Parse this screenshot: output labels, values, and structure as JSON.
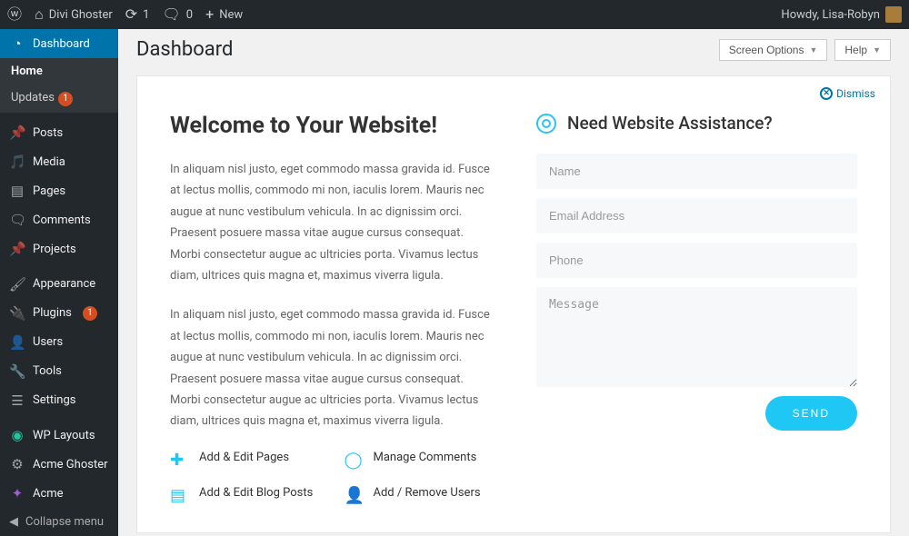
{
  "adminbar": {
    "site_name": "Divi Ghoster",
    "updates_count": "1",
    "comments_count": "0",
    "new_label": "New",
    "howdy": "Howdy, Lisa-Robyn"
  },
  "sidebar": {
    "dashboard": "Dashboard",
    "home": "Home",
    "updates": "Updates",
    "updates_badge": "1",
    "posts": "Posts",
    "media": "Media",
    "pages": "Pages",
    "comments": "Comments",
    "projects": "Projects",
    "appearance": "Appearance",
    "plugins": "Plugins",
    "plugins_badge": "1",
    "users": "Users",
    "tools": "Tools",
    "settings": "Settings",
    "wp_layouts": "WP Layouts",
    "acme_ghoster": "Acme Ghoster",
    "acme": "Acme",
    "collapse": "Collapse menu"
  },
  "page": {
    "title": "Dashboard",
    "screen_options": "Screen Options",
    "help": "Help",
    "dismiss": "Dismiss"
  },
  "welcome": {
    "heading": "Welcome to Your Website!",
    "p1": "In aliquam nisl justo, eget commodo massa gravida id. Fusce at lectus mollis, commodo mi non, iaculis lorem. Mauris nec augue at nunc vestibulum vehicula. In ac dignissim orci. Praesent posuere massa vitae augue cursus consequat. Morbi consectetur augue ac ultricies porta. Vivamus lectus diam, ultrices quis magna et, maximus viverra ligula.",
    "p2": "In aliquam nisl justo, eget commodo massa gravida id. Fusce at lectus mollis, commodo mi non, iaculis lorem. Mauris nec augue at nunc vestibulum vehicula. In ac dignissim orci. Praesent posuere massa vitae augue cursus consequat. Morbi consectetur augue ac ultricies porta. Vivamus lectus diam, ultrices quis magna et, maximus viverra ligula."
  },
  "assist": {
    "heading": "Need Website Assistance?",
    "name_ph": "Name",
    "email_ph": "Email Address",
    "phone_ph": "Phone",
    "message_ph": "Message",
    "send": "SEND"
  },
  "quick": {
    "pages": "Add & Edit Pages",
    "comments": "Manage Comments",
    "posts": "Add & Edit Blog Posts",
    "users": "Add / Remove Users"
  }
}
